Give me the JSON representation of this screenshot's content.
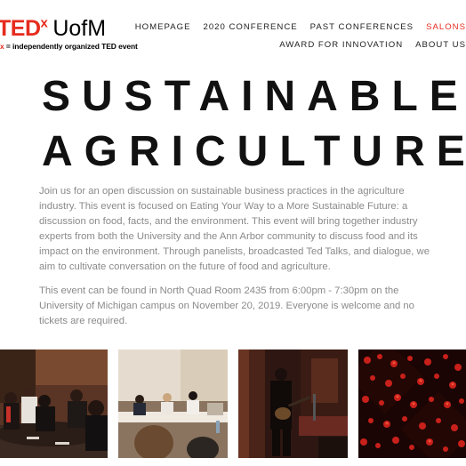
{
  "logo": {
    "ted": "TED",
    "x": "x",
    "name": "UofM",
    "tag_x": "x",
    "tagline": " = independently organized TED event"
  },
  "nav": {
    "row1": [
      "HOMEPAGE",
      "2020 CONFERENCE",
      "PAST CONFERENCES",
      "SALONS"
    ],
    "row2": [
      "AWARD FOR INNOVATION",
      "ABOUT US"
    ],
    "active": "SALONS"
  },
  "page": {
    "title_line1": "SUSTAINABLE",
    "title_line2": "AGRICULTURE",
    "paragraph1": "Join us for an open discussion on sustainable business practices in the agriculture industry. This event is focused on Eating Your Way to a More Sustainable Future: a discussion on food, facts, and the environment. This event will bring together industry experts from both the University and the Ann Arbor community to discuss food and its impact on the environment. Through panelists, broadcasted Ted Talks, and dialogue, we aim to cultivate conversation on the future of food and agriculture.",
    "paragraph2": "This event can be found in North Quad Room 2435 from 6:00pm - 7:30pm on the University of Michigan campus on November 20, 2019. Everyone is welcome and no tickets are required."
  },
  "colors": {
    "accent": "#e62b1e",
    "body_text": "#8a8a8a",
    "title": "#111111"
  }
}
